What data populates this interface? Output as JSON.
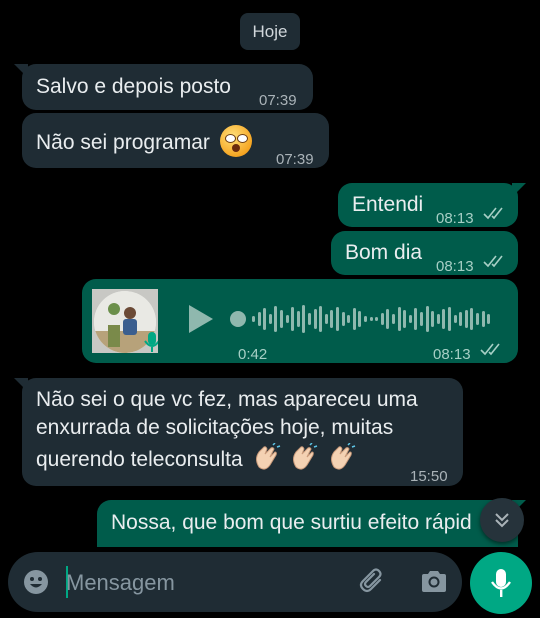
{
  "date_chip": "Hoje",
  "messages": [
    {
      "text": "Salvo e depois posto",
      "time": "07:39",
      "direction": "in"
    },
    {
      "text": "Não sei programar",
      "emoji": "flushed-face",
      "time": "07:39",
      "direction": "in"
    },
    {
      "text": "Entendi",
      "time": "08:13",
      "direction": "out",
      "status": "read"
    },
    {
      "text": "Bom dia",
      "time": "08:13",
      "direction": "out",
      "status": "read"
    },
    {
      "type": "voice",
      "duration": "0:42",
      "time": "08:13",
      "direction": "out",
      "status": "read"
    },
    {
      "lines": [
        "Não sei o que vc fez, mas apareceu uma",
        "enxurrada de solicitações hoje, muitas",
        "querendo teleconsulta"
      ],
      "emoji": "clapping-hands x3",
      "time": "15:50",
      "direction": "in"
    },
    {
      "text": "Nossa, que bom que surtiu efeito rápid",
      "direction": "out"
    }
  ],
  "composer": {
    "placeholder": "Mensagem"
  },
  "colors": {
    "background": "#000000",
    "incoming": "#1f2c34",
    "outgoing": "#005c4b",
    "accent": "#00a884"
  }
}
